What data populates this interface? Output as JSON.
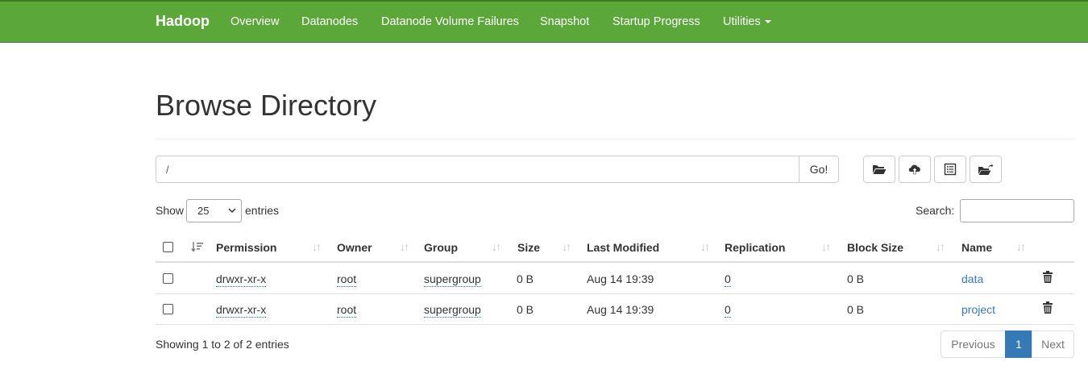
{
  "navbar": {
    "brand": "Hadoop",
    "links": [
      "Overview",
      "Datanodes",
      "Datanode Volume Failures",
      "Snapshot",
      "Startup Progress",
      "Utilities"
    ]
  },
  "page": {
    "title": "Browse Directory"
  },
  "path_bar": {
    "value": "/",
    "go_label": "Go!"
  },
  "toolbar": {
    "icons": [
      "folder-open-icon",
      "cloud-upload-icon",
      "list-icon",
      "folder-move-icon"
    ]
  },
  "length_control": {
    "show_label": "Show",
    "value": "25",
    "entries_label": "entries"
  },
  "search": {
    "label": "Search:",
    "value": ""
  },
  "table": {
    "columns": [
      "Permission",
      "Owner",
      "Group",
      "Size",
      "Last Modified",
      "Replication",
      "Block Size",
      "Name"
    ],
    "rows": [
      {
        "permission": "drwxr-xr-x",
        "owner": "root",
        "group": "supergroup",
        "size": "0 B",
        "last_modified": "Aug 14 19:39",
        "replication": "0",
        "block_size": "0 B",
        "name": "data"
      },
      {
        "permission": "drwxr-xr-x",
        "owner": "root",
        "group": "supergroup",
        "size": "0 B",
        "last_modified": "Aug 14 19:39",
        "replication": "0",
        "block_size": "0 B",
        "name": "project"
      }
    ]
  },
  "footer": {
    "info": "Showing 1 to 2 of 2 entries"
  },
  "pagination": {
    "previous": "Previous",
    "current": "1",
    "next": "Next"
  },
  "colors": {
    "navbar": "#5ba73a",
    "link": "#337ab7",
    "active_page": "#337ab7"
  }
}
